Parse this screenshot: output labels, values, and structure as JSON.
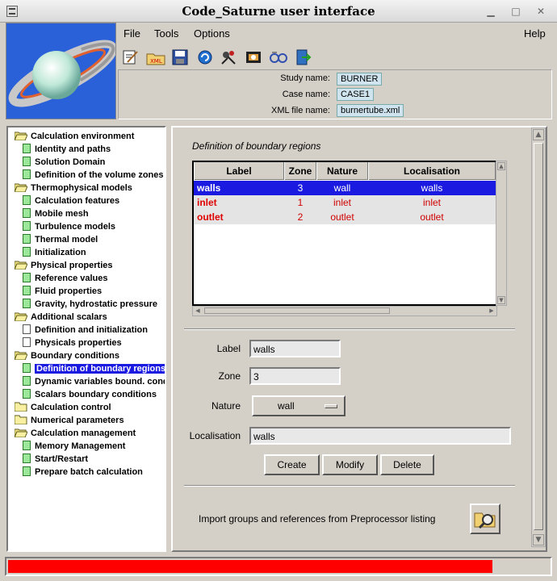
{
  "window": {
    "title": "Code_Saturne user interface"
  },
  "menu": {
    "file": "File",
    "tools": "Tools",
    "options": "Options",
    "help": "Help"
  },
  "toolbar_icons": [
    "edit-icon",
    "open-xml-icon",
    "save-icon",
    "refresh-icon",
    "launch-icon",
    "preprocessor-icon",
    "batch-icon",
    "quit-icon"
  ],
  "study": {
    "study_label": "Study name:",
    "study_value": "BURNER",
    "case_label": "Case name:",
    "case_value": "CASE1",
    "xml_label": "XML file name:",
    "xml_value": "burnertube.xml"
  },
  "tree": [
    {
      "label": "Calculation environment",
      "type": "folder",
      "level": 0
    },
    {
      "label": "Identity and paths",
      "type": "green",
      "level": 1
    },
    {
      "label": "Solution Domain",
      "type": "green",
      "level": 1
    },
    {
      "label": "Definition of the volume zones",
      "type": "green",
      "level": 1
    },
    {
      "label": "Thermophysical models",
      "type": "folder",
      "level": 0
    },
    {
      "label": "Calculation features",
      "type": "green",
      "level": 1
    },
    {
      "label": "Mobile mesh",
      "type": "green",
      "level": 1
    },
    {
      "label": "Turbulence models",
      "type": "green",
      "level": 1
    },
    {
      "label": "Thermal model",
      "type": "green",
      "level": 1
    },
    {
      "label": "Initialization",
      "type": "green",
      "level": 1
    },
    {
      "label": "Physical properties",
      "type": "folder",
      "level": 0
    },
    {
      "label": "Reference values",
      "type": "green",
      "level": 1
    },
    {
      "label": "Fluid properties",
      "type": "green",
      "level": 1
    },
    {
      "label": "Gravity, hydrostatic pressure",
      "type": "green",
      "level": 1
    },
    {
      "label": "Additional scalars",
      "type": "folder",
      "level": 0
    },
    {
      "label": "Definition and initialization",
      "type": "white",
      "level": 1
    },
    {
      "label": "Physicals properties",
      "type": "white",
      "level": 1
    },
    {
      "label": "Boundary conditions",
      "type": "folder",
      "level": 0
    },
    {
      "label": "Definition of boundary regions",
      "type": "green",
      "level": 1,
      "selected": true
    },
    {
      "label": "Dynamic variables bound. cond.",
      "type": "green",
      "level": 1
    },
    {
      "label": "Scalars boundary conditions",
      "type": "green",
      "level": 1
    },
    {
      "label": "Calculation control",
      "type": "folder-closed",
      "level": 0
    },
    {
      "label": "Numerical parameters",
      "type": "folder-closed",
      "level": 0
    },
    {
      "label": "Calculation management",
      "type": "folder",
      "level": 0
    },
    {
      "label": "Memory Management",
      "type": "green",
      "level": 1
    },
    {
      "label": "Start/Restart",
      "type": "green",
      "level": 1
    },
    {
      "label": "Prepare batch calculation",
      "type": "green",
      "level": 1
    }
  ],
  "boundary": {
    "title": "Definition of boundary regions",
    "columns": [
      "Label",
      "Zone",
      "Nature",
      "Localisation"
    ],
    "rows": [
      {
        "label": "walls",
        "zone": "3",
        "nature": "wall",
        "localisation": "walls"
      },
      {
        "label": "inlet",
        "zone": "1",
        "nature": "inlet",
        "localisation": "inlet"
      },
      {
        "label": "outlet",
        "zone": "2",
        "nature": "outlet",
        "localisation": "outlet"
      }
    ]
  },
  "form": {
    "label_label": "Label",
    "label_value": "walls",
    "zone_label": "Zone",
    "zone_value": "3",
    "nature_label": "Nature",
    "nature_value": "wall",
    "localisation_label": "Localisation",
    "localisation_value": "walls",
    "create": "Create",
    "modify": "Modify",
    "delete": "Delete"
  },
  "import": {
    "text": "Import groups and references from Preprocessor listing"
  },
  "status": {
    "progress": 0.89,
    "color": "#ff0000"
  }
}
